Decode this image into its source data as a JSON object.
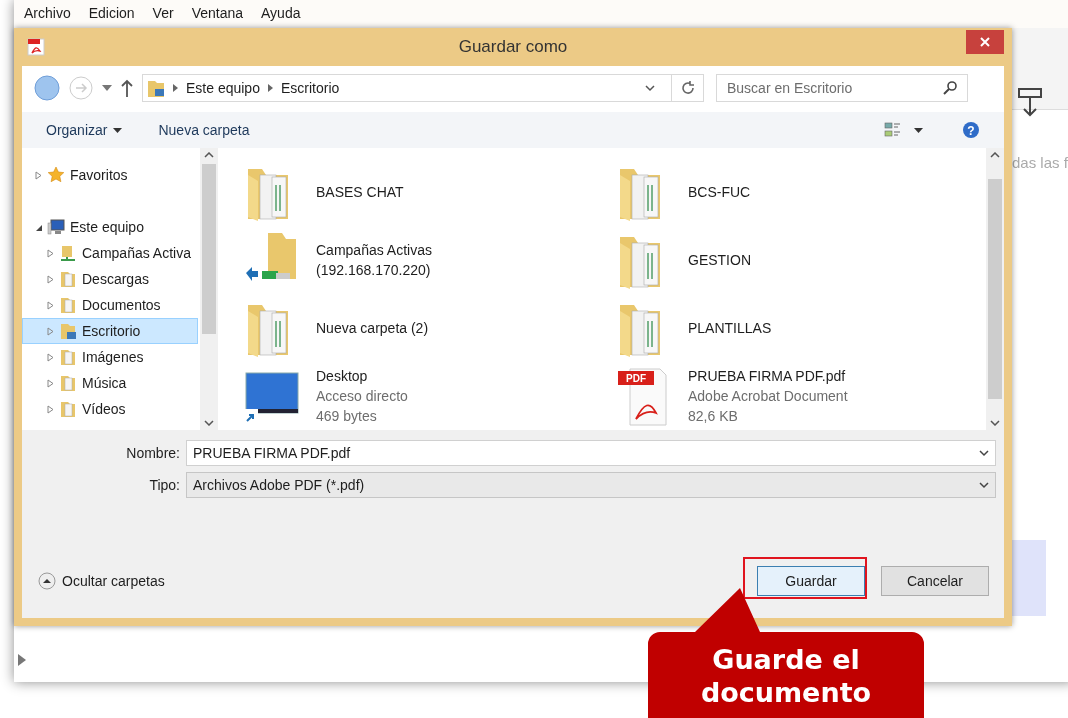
{
  "app_menu": [
    "Archivo",
    "Edicion",
    "Ver",
    "Ventana",
    "Ayuda"
  ],
  "background_text": "das las f",
  "dialog": {
    "title": "Guardar como",
    "breadcrumb": [
      "Este equipo",
      "Escritorio"
    ],
    "search": {
      "placeholder": "Buscar en Escritorio"
    },
    "toolbar": {
      "organize": "Organizar",
      "new_folder": "Nueva carpeta",
      "help": "?"
    },
    "nav": [
      {
        "label": "Favoritos",
        "kind": "favorites",
        "expanded": false,
        "selected": false
      },
      {
        "label": "Este equipo",
        "kind": "computer",
        "expanded": true,
        "selected": false,
        "children": [
          {
            "label": "Campañas Activa",
            "kind": "network",
            "expanded": false,
            "selected": false
          },
          {
            "label": "Descargas",
            "kind": "folder",
            "expanded": false,
            "selected": false
          },
          {
            "label": "Documentos",
            "kind": "folder",
            "expanded": false,
            "selected": false
          },
          {
            "label": "Escritorio",
            "kind": "desktop",
            "expanded": false,
            "selected": true
          },
          {
            "label": "Imágenes",
            "kind": "folder",
            "expanded": false,
            "selected": false
          },
          {
            "label": "Música",
            "kind": "folder",
            "expanded": false,
            "selected": false
          },
          {
            "label": "Vídeos",
            "kind": "folder",
            "expanded": false,
            "selected": false
          }
        ]
      }
    ],
    "files": [
      {
        "kind": "folder",
        "name": "BASES CHAT"
      },
      {
        "kind": "folder",
        "name": "BCS-FUC"
      },
      {
        "kind": "network",
        "name": "Campañas Activas",
        "details": [
          "(192.168.170.220)"
        ]
      },
      {
        "kind": "folder",
        "name": "GESTION"
      },
      {
        "kind": "folder",
        "name": "Nueva carpeta (2)"
      },
      {
        "kind": "folder",
        "name": "PLANTILLAS"
      },
      {
        "kind": "shortcut",
        "name": "Desktop",
        "details": [
          "Acceso directo",
          "469 bytes"
        ]
      },
      {
        "kind": "pdf",
        "badge": "PDF",
        "name": "PRUEBA FIRMA PDF.pdf",
        "details": [
          "Adobe Acrobat Document",
          "82,6 KB"
        ]
      }
    ],
    "fields": [
      {
        "label": "Nombre:",
        "value": "PRUEBA FIRMA PDF.pdf",
        "kind": "input"
      },
      {
        "label": "Tipo:",
        "value": "Archivos Adobe PDF (*.pdf)",
        "kind": "select"
      }
    ],
    "hide_folders": "Ocultar carpetas",
    "buttons": [
      {
        "label": "Guardar",
        "highlighted": true
      },
      {
        "label": "Cancelar",
        "highlighted": false
      }
    ]
  },
  "callout": "Guarde el documento"
}
